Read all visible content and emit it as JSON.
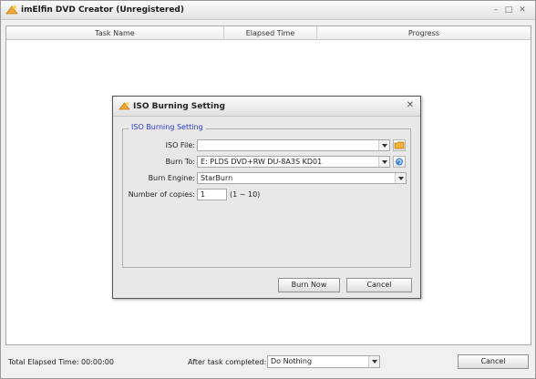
{
  "window": {
    "title": "imElfin DVD Creator (Unregistered)",
    "controls": [
      "minimize-icon",
      "maximize-icon",
      "close-icon"
    ]
  },
  "list": {
    "columns": [
      "Task Name",
      "Elapsed Time",
      "Progress"
    ]
  },
  "dialog": {
    "title": "ISO Burning Setting",
    "group_title": "ISO Burning Setting",
    "iso_file": {
      "label": "ISO File:",
      "value": ""
    },
    "burn_to": {
      "label": "Burn To:",
      "value": "E: PLDS DVD+RW DU-8A3S KD01"
    },
    "burn_engine": {
      "label": "Burn Engine:",
      "value": "StarBurn"
    },
    "copies": {
      "label": "Number of copies:",
      "value": "1",
      "hint": "(1 ~ 10)"
    },
    "burn_now_label": "Burn Now",
    "cancel_label": "Cancel"
  },
  "status": {
    "elapsed": "Total Elapsed Time: 00:00:00",
    "after_label": "After task completed:",
    "after_value": "Do Nothing",
    "cancel_label": "Cancel"
  },
  "colors": {
    "group_title": "#2a34d8",
    "folder": "#f2b233",
    "refresh": "#3c86d8"
  }
}
